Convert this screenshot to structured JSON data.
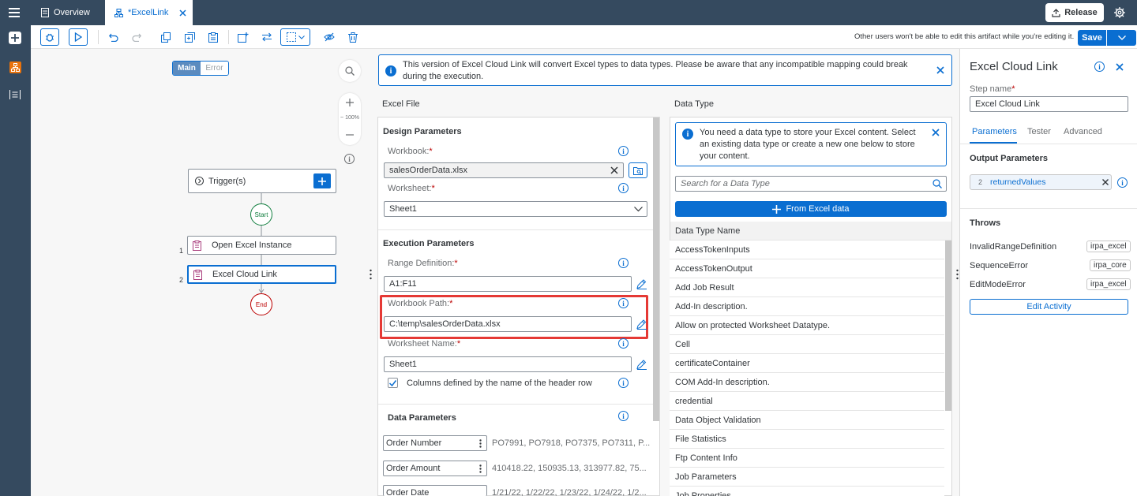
{
  "header": {
    "tabs": [
      {
        "label": "Overview"
      },
      {
        "label": "*ExcelLink"
      }
    ],
    "release_label": "Release"
  },
  "toolbar": {
    "lock_notice": "Other users won't be able to edit this artifact while you're editing it.",
    "save_label": "Save"
  },
  "canvas": {
    "mode_tabs": [
      "Main",
      "Error"
    ],
    "zoom_label": "~ 100%",
    "trigger_label": "Trigger(s)",
    "start_label": "Start",
    "end_label": "End",
    "steps": [
      {
        "index": "1",
        "label": "Open Excel Instance"
      },
      {
        "index": "2",
        "label": "Excel Cloud Link"
      }
    ]
  },
  "banner": {
    "text": "This version of Excel Cloud Link will convert Excel types to data types. Please be aware that any incompatible mapping could break during the execution."
  },
  "excel_file": {
    "title": "Excel File",
    "design_title": "Design Parameters",
    "workbook_label": "Workbook:",
    "workbook_value": "salesOrderData.xlsx",
    "worksheet_label": "Worksheet:",
    "worksheet_value": "Sheet1",
    "execution_title": "Execution Parameters",
    "range_label": "Range Definition:",
    "range_value": "A1:F11",
    "path_label": "Workbook Path:",
    "path_value": "C:\\temp\\salesOrderData.xlsx",
    "sheet_name_label": "Worksheet Name:",
    "sheet_name_value": "Sheet1",
    "header_checkbox_label": "Columns defined by the name of the header row",
    "data_title": "Data Parameters",
    "data_params": [
      {
        "name": "Order Number",
        "preview": "PO7991, PO7918, PO7375, PO7311, P..."
      },
      {
        "name": "Order Amount",
        "preview": "410418.22, 150935.13, 313977.82, 75..."
      },
      {
        "name": "Order Date",
        "preview": "1/21/22, 1/22/22, 1/23/22, 1/24/22, 1/2..."
      }
    ]
  },
  "data_type": {
    "title": "Data Type",
    "info_text": "You need a data type to store your Excel content. Select an existing data type or create a new one below to store your content.",
    "search_placeholder": "Search for a Data Type",
    "from_excel_label": "From Excel data",
    "column_header": "Data Type Name",
    "rows": [
      "AccessTokenInputs",
      "AccessTokenOutput",
      "Add Job Result",
      "Add-In description.",
      "Allow on protected Worksheet Datatype.",
      "Cell",
      "certificateContainer",
      "COM Add-In description.",
      "credential",
      "Data Object Validation",
      "File Statistics",
      "Ftp Content Info",
      "Job Parameters",
      "Job Properties"
    ]
  },
  "side_panel": {
    "title": "Excel Cloud Link",
    "step_name_label": "Step name",
    "step_name_value": "Excel Cloud Link",
    "tabs": [
      "Parameters",
      "Tester",
      "Advanced"
    ],
    "output_title": "Output Parameters",
    "output_count": "2",
    "output_name": "returnedValues",
    "throws_title": "Throws",
    "throws": [
      {
        "name": "InvalidRangeDefinition",
        "lib": "irpa_excel"
      },
      {
        "name": "SequenceError",
        "lib": "irpa_core"
      },
      {
        "name": "EditModeError",
        "lib": "irpa_excel"
      }
    ],
    "edit_activity_label": "Edit Activity"
  },
  "colors": {
    "shell": "#354a5f",
    "accent": "#0a6ed1",
    "highlight": "#e53935",
    "start": "#107e3e",
    "end": "#bb0000",
    "step_icon": "#a93e7d"
  }
}
